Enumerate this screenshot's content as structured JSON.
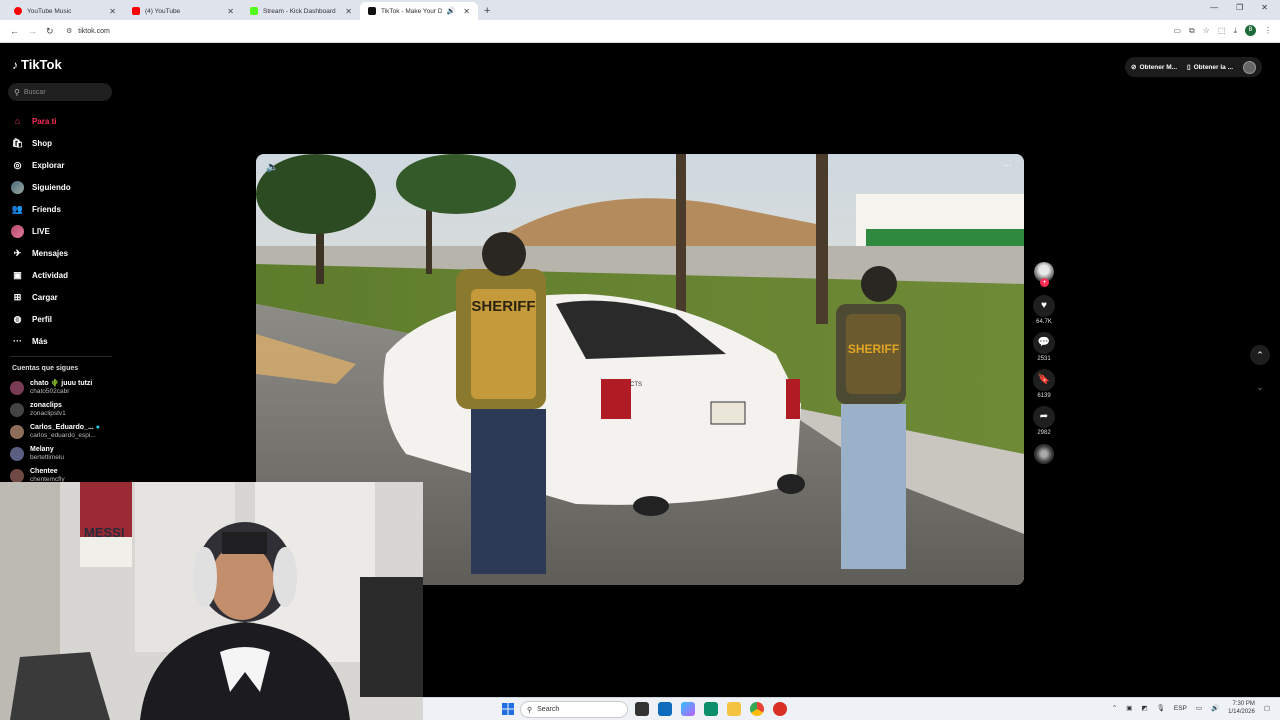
{
  "browser": {
    "tabs": [
      {
        "title": "YouTube Music",
        "color": "#ff0000"
      },
      {
        "title": "(4) YouTube",
        "color": "#ff0000"
      },
      {
        "title": "Stream - Kick Dashboard",
        "color": "#53fc18"
      },
      {
        "title": "TikTok - Make Your Day",
        "color": "#111111"
      }
    ],
    "url": "tiktok.com",
    "profile_initial": "B"
  },
  "sidebar": {
    "logo": "TikTok",
    "search_placeholder": "Buscar",
    "nav": [
      {
        "label": "Para ti",
        "icon": "home-icon"
      },
      {
        "label": "Shop",
        "icon": "shop-icon"
      },
      {
        "label": "Explorar",
        "icon": "compass-icon"
      },
      {
        "label": "Siguiendo",
        "icon": "avatar-icon"
      },
      {
        "label": "Friends",
        "icon": "friends-icon"
      },
      {
        "label": "LIVE",
        "icon": "live-icon"
      },
      {
        "label": "Mensajes",
        "icon": "send-icon"
      },
      {
        "label": "Actividad",
        "icon": "inbox-icon"
      },
      {
        "label": "Cargar",
        "icon": "upload-icon"
      },
      {
        "label": "Perfil",
        "icon": "profile-icon"
      },
      {
        "label": "Más",
        "icon": "more-icon"
      }
    ],
    "following_title": "Cuentas que sigues",
    "following": [
      {
        "name": "chato 🌵 juuu tutzi",
        "handle": "chato502cabr"
      },
      {
        "name": "zonaclips",
        "handle": "zonaclipstv1"
      },
      {
        "name": "Carlos_Eduardo_...",
        "handle": "carlos_eduardo_espi..."
      },
      {
        "name": "Melany",
        "handle": "bertettimelu"
      },
      {
        "name": "Chentee",
        "handle": "chentemcfly"
      }
    ]
  },
  "topright": {
    "btn1": "Obtener M...",
    "btn2": "Obtener la ..."
  },
  "video": {
    "sign_text": "SHERIFF",
    "badge": "CTS"
  },
  "actions": {
    "likes": "64.7K",
    "comments": "2531",
    "saves": "6139",
    "shares": "2982"
  },
  "taskbar": {
    "search_placeholder": "Search",
    "lang": "ESP",
    "time": "7:30 PM",
    "date": "1/14/2026"
  },
  "colors": {
    "accent": "#fe2c55"
  }
}
